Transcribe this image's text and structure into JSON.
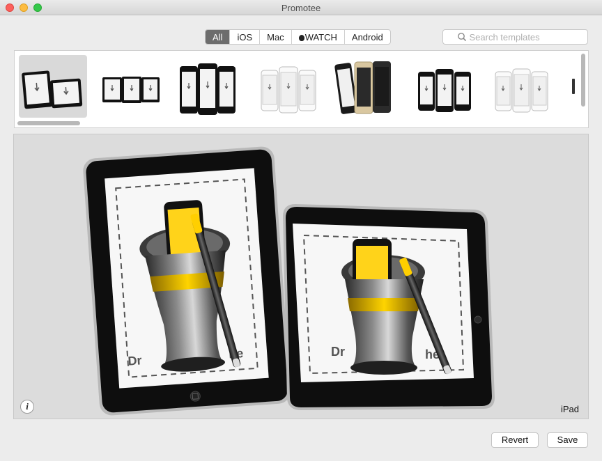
{
  "window": {
    "title": "Promotee"
  },
  "filters": {
    "items": [
      {
        "label": "All",
        "active": true
      },
      {
        "label": "iOS",
        "active": false
      },
      {
        "label": "Mac",
        "active": false
      },
      {
        "label": "WATCH",
        "active": false,
        "icon": "apple-icon"
      },
      {
        "label": "Android",
        "active": false
      }
    ]
  },
  "search": {
    "placeholder": "Search templates",
    "value": ""
  },
  "templates": {
    "items": [
      {
        "name": "ipad-pair",
        "selected": true
      },
      {
        "name": "ipad-triple",
        "selected": false
      },
      {
        "name": "iphone-black-triple",
        "selected": false
      },
      {
        "name": "iphone-white-triple",
        "selected": false
      },
      {
        "name": "iphone-gold-triple",
        "selected": false
      },
      {
        "name": "iphone-5c-triple",
        "selected": false
      },
      {
        "name": "iphone-white-triple-2",
        "selected": false
      }
    ]
  },
  "preview": {
    "device_label": "iPad",
    "info_label": "i",
    "screen_caption": "Drop screenshot here"
  },
  "actions": {
    "revert_label": "Revert",
    "save_label": "Save"
  },
  "colors": {
    "active_segment": "#6d6d6d",
    "accent_gold": "#f5c400"
  }
}
